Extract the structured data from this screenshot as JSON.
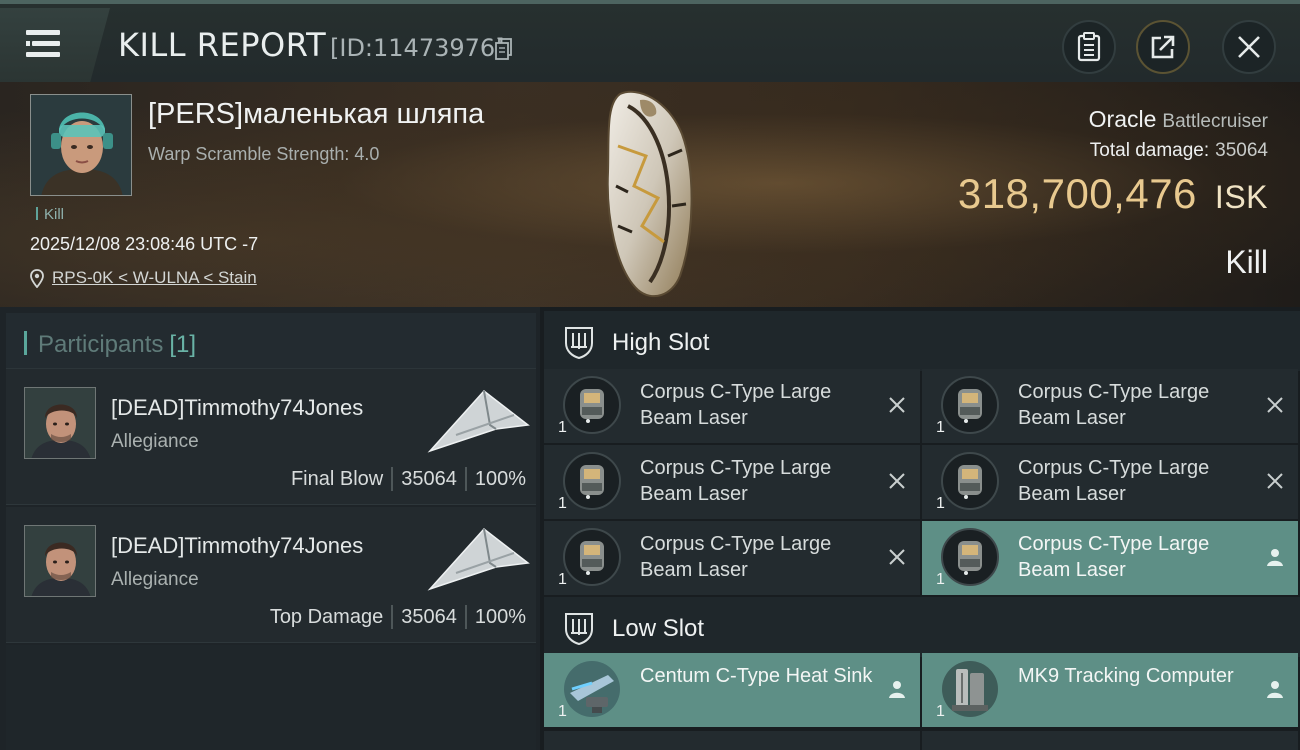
{
  "topbar": {
    "title": "KILL REPORT",
    "report_id": "[ID:11473976]"
  },
  "victim": {
    "name": "[PERS]маленькая шляпа",
    "warp_scramble": "Warp Scramble Strength: 4.0",
    "tag": "Kill",
    "datetime": "2025/12/08 23:08:46 UTC -7",
    "location": "RPS-0K < W-ULNA < Stain",
    "ship_name": "Oracle",
    "ship_class": "Battlecruiser",
    "total_damage_label": "Total damage:",
    "total_damage": "35064",
    "isk_value": "318,700,476",
    "isk_unit": "ISK",
    "result": "Kill"
  },
  "participants": {
    "title": "Participants",
    "count": "[1]",
    "rows": [
      {
        "name": "[DEAD]Timmothy74Jones",
        "corp": "Allegiance",
        "role": "Final Blow",
        "damage": "35064",
        "percent": "100%"
      },
      {
        "name": "[DEAD]Timmothy74Jones",
        "corp": "Allegiance",
        "role": "Top Damage",
        "damage": "35064",
        "percent": "100%"
      }
    ]
  },
  "fitting": {
    "high_slot_label": "High Slot",
    "low_slot_label": "Low Slot",
    "high": [
      {
        "qty": "1",
        "name": "Corpus C-Type Large Beam Laser",
        "status": "destroyed"
      },
      {
        "qty": "1",
        "name": "Corpus C-Type Large Beam Laser",
        "status": "destroyed"
      },
      {
        "qty": "1",
        "name": "Corpus C-Type Large Beam Laser",
        "status": "destroyed"
      },
      {
        "qty": "1",
        "name": "Corpus C-Type Large Beam Laser",
        "status": "destroyed"
      },
      {
        "qty": "1",
        "name": "Corpus C-Type Large Beam Laser",
        "status": "destroyed"
      },
      {
        "qty": "1",
        "name": "Corpus C-Type Large Beam Laser",
        "status": "dropped"
      }
    ],
    "low": [
      {
        "qty": "1",
        "name": "Centum C-Type Heat Sink",
        "status": "dropped"
      },
      {
        "qty": "1",
        "name": "MK9 Tracking Computer",
        "status": "dropped"
      }
    ]
  },
  "colors": {
    "accent": "#5aa79b",
    "isk": "#e8c98f",
    "dropped_bg": "#5e8f86",
    "panel": "#232b2f"
  }
}
